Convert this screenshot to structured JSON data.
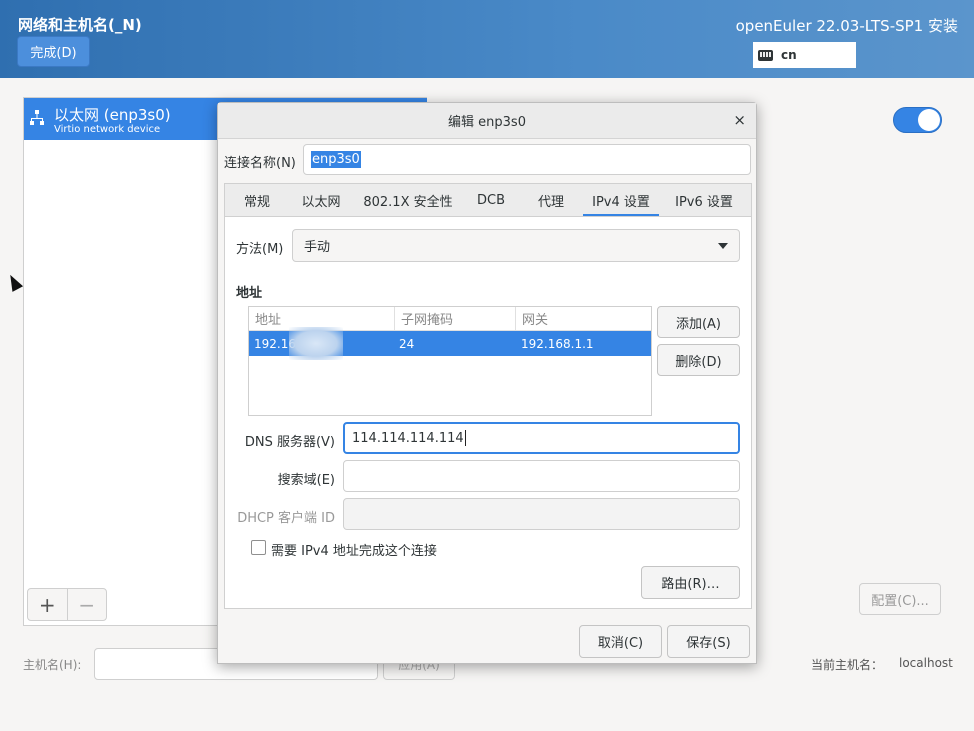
{
  "header": {
    "title": "网络和主机名(_N)",
    "done_label": "完成(D)",
    "product": "openEuler 22.03-LTS-SP1 安装",
    "keyboard_layout": "cn"
  },
  "device_list": {
    "items": [
      {
        "name": "以太网 (enp3s0)",
        "subtitle": "Virtio network device",
        "selected": true
      }
    ],
    "add_label": "+",
    "remove_label": "−"
  },
  "toggle": {
    "state": "on"
  },
  "configure_label": "配置(C)...",
  "hostname": {
    "label": "主机名(H):",
    "value": "",
    "apply_label": "应用(A)",
    "current_label": "当前主机名：",
    "current_value": "localhost"
  },
  "dialog": {
    "title": "编辑 enp3s0",
    "close_glyph": "×",
    "connection_name_label": "连接名称(N)",
    "connection_name_value": "enp3s0",
    "tabs": [
      {
        "label": "常规"
      },
      {
        "label": "以太网"
      },
      {
        "label": "802.1X 安全性"
      },
      {
        "label": "DCB"
      },
      {
        "label": "代理"
      },
      {
        "label": "IPv4 设置",
        "active": true
      },
      {
        "label": "IPv6 设置"
      }
    ],
    "method_label": "方法(M)",
    "method_value": "手动",
    "addresses_title": "地址",
    "table": {
      "columns": [
        "地址",
        "子网掩码",
        "网关"
      ],
      "rows": [
        {
          "address": "192.16",
          "netmask": "24",
          "gateway": "192.168.1.1"
        }
      ]
    },
    "add_button": "添加(A)",
    "delete_button": "删除(D)",
    "dns_label": "DNS 服务器(V)",
    "dns_value": "114.114.114.114",
    "search_label": "搜索域(E)",
    "search_value": "",
    "dhcp_label": "DHCP 客户端 ID",
    "dhcp_value": "",
    "require_ipv4_label": "需要 IPv4 地址完成这个连接",
    "require_ipv4_checked": false,
    "routes_button": "路由(R)…",
    "cancel_button": "取消(C)",
    "save_button": "保存(S)"
  },
  "colors": {
    "accent": "#3584e4",
    "header_bg": "#3e7fc1"
  }
}
